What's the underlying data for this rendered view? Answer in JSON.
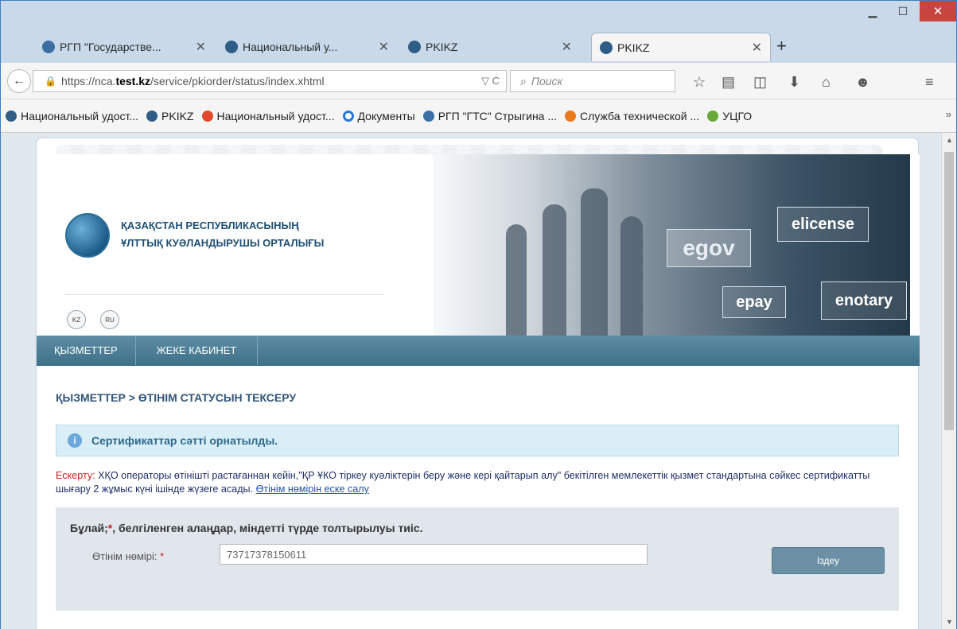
{
  "browser": {
    "tabs": [
      {
        "title": "РГП \"Государстве...",
        "active": false
      },
      {
        "title": "Национальный у...",
        "active": false
      },
      {
        "title": "PKIKZ",
        "active": false
      },
      {
        "title": "PKIKZ",
        "active": true
      }
    ],
    "url": {
      "prefix": "https://nca.",
      "domain": "test.kz",
      "path": "/service/pkiorder/status/index.xhtml"
    },
    "search_placeholder": "Поиск",
    "bookmarks": [
      {
        "label": "Национальный удост..."
      },
      {
        "label": "PKIKZ"
      },
      {
        "label": "Национальный удост..."
      },
      {
        "label": "Документы"
      },
      {
        "label": "РГП \"ГТС\" Стрыгина ..."
      },
      {
        "label": "Служба технической ..."
      },
      {
        "label": "УЦГО"
      }
    ]
  },
  "site": {
    "org_line1": "ҚАЗАҚСТАН РЕСПУБЛИКАСЫНЫҢ",
    "org_line2": "ҰЛТТЫҚ КУӘЛАНДЫРУШЫ ОРТАЛЫҒЫ",
    "lang_kz": "KZ",
    "lang_ru": "RU",
    "banner": {
      "gov": "egov",
      "license": "elicense",
      "pay": "epay",
      "notary": "enotary"
    },
    "menu": [
      "ҚЫЗМЕТТЕР",
      "ЖЕКЕ КАБИНЕТ"
    ],
    "breadcrumb": "ҚЫЗМЕТТЕР > ӨТІНІМ СТАТУСЫН ТЕКСЕРУ",
    "info_message": "Сертификаттар сәтті орнатылды.",
    "note": {
      "label": "Ескерту:",
      "text": " ХҚО операторы өтінішті растағаннан кейін,\"ҚР ҰКО тіркеу куәліктерін беру және кері қайтарып алу\" бекітілген мемлекеттік қызмет стандартына сәйкес сертификатты шығару 2 жұмыс күні ішінде жүзеге асады. ",
      "link": "Өтінім нөмірін еске салу"
    },
    "form": {
      "required_note_pre": "Бұлай;",
      "required_note_ast": "*",
      "required_note_post": ", белгіленген алаңдар, міндетті түрде толтырылуы тиіс.",
      "field_label": "Өтінім нөмірі:",
      "field_ast": "*",
      "field_value": "73717378150611",
      "button": "Іздеу"
    }
  }
}
